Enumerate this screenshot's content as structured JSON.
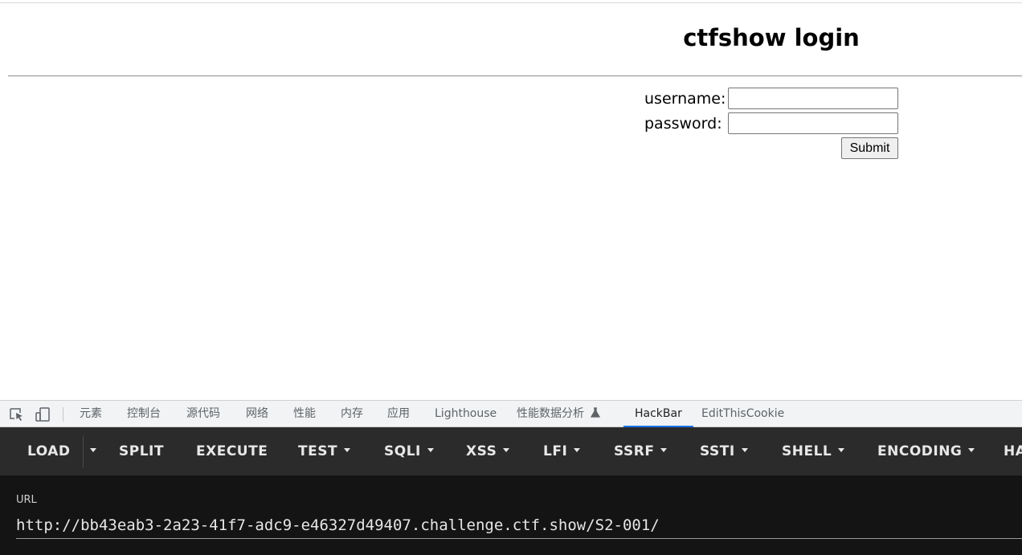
{
  "page": {
    "title": "ctfshow login",
    "form": {
      "username_label": "username:",
      "username_value": "",
      "password_label": "password:",
      "password_value": "",
      "submit_label": "Submit"
    }
  },
  "devtools": {
    "tabs": [
      {
        "label": "元素"
      },
      {
        "label": "控制台"
      },
      {
        "label": "源代码"
      },
      {
        "label": "网络"
      },
      {
        "label": "性能"
      },
      {
        "label": "内存"
      },
      {
        "label": "应用"
      },
      {
        "label": "Lighthouse"
      },
      {
        "label": "性能数据分析"
      },
      {
        "label": "HackBar",
        "active": true
      },
      {
        "label": "EditThisCookie"
      }
    ],
    "icons": [
      "inspect-element-icon",
      "device-toolbar-icon",
      "flask-icon"
    ],
    "accent_color": "#1a73e8"
  },
  "hackbar": {
    "buttons": [
      {
        "label": "LOAD",
        "dropdown": false
      },
      {
        "label": "SPLIT",
        "dropdown": false
      },
      {
        "label": "EXECUTE",
        "dropdown": false
      },
      {
        "label": "TEST",
        "dropdown": true
      },
      {
        "label": "SQLI",
        "dropdown": true
      },
      {
        "label": "XSS",
        "dropdown": true
      },
      {
        "label": "LFI",
        "dropdown": true
      },
      {
        "label": "SSRF",
        "dropdown": true
      },
      {
        "label": "SSTI",
        "dropdown": true
      },
      {
        "label": "SHELL",
        "dropdown": true
      },
      {
        "label": "ENCODING",
        "dropdown": true
      },
      {
        "label": "HA",
        "dropdown": false
      }
    ],
    "url_label": "URL",
    "url_value": "http://bb43eab3-2a23-41f7-adc9-e46327d49407.challenge.ctf.show/S2-001/"
  }
}
